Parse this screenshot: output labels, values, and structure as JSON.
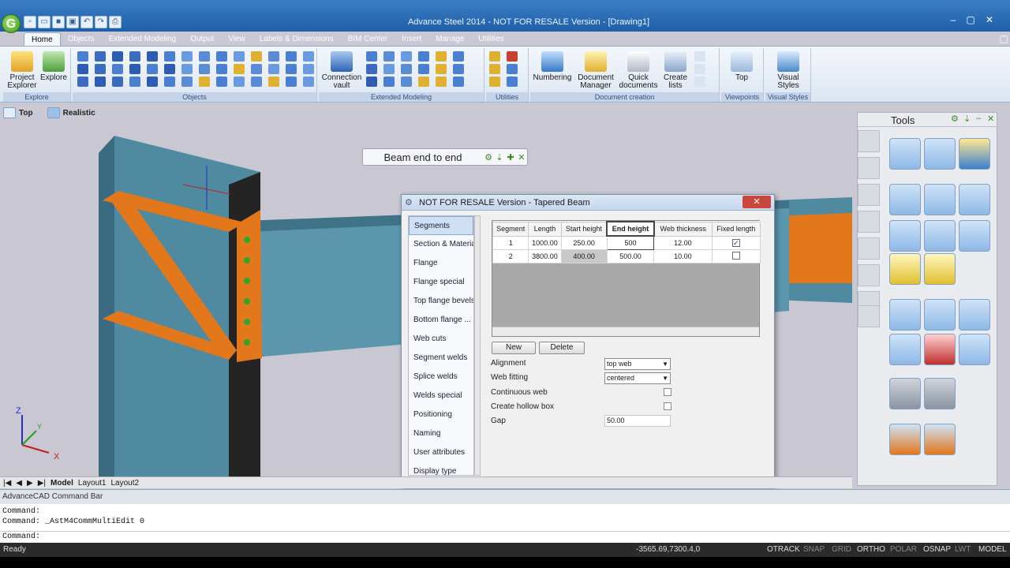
{
  "window": {
    "title": "Advance Steel 2014 - NOT FOR RESALE Version - [Drawing1]",
    "logo": "G"
  },
  "tabs": [
    "Home",
    "Objects",
    "Extended Modeling",
    "Output",
    "View",
    "Labels & Dimensions",
    "BIM Center",
    "Insert",
    "Manage",
    "Utilities"
  ],
  "ribbon": {
    "explore": {
      "label": "Explore",
      "project_explorer": "Project Explorer",
      "explore": "Explore"
    },
    "objects": {
      "label": "Objects"
    },
    "extended_modeling": {
      "label": "Extended Modeling",
      "connection_vault": "Connection vault"
    },
    "utilities": {
      "label": "Utilities"
    },
    "document_creation": {
      "label": "Document creation",
      "numbering": "Numbering",
      "document_manager": "Document Manager",
      "quick_documents": "Quick documents",
      "create_lists": "Create lists"
    },
    "viewpoints": {
      "label": "Viewpoints",
      "top": "Top"
    },
    "visual_styles": {
      "label": "Visual Styles",
      "visual_styles": "Visual Styles"
    }
  },
  "viewbar": {
    "view": "Top",
    "style": "Realistic"
  },
  "floating_toolbar": {
    "label": "Beam end to end"
  },
  "tools_palette": {
    "title": "Tools"
  },
  "dialog": {
    "title": "NOT FOR RESALE Version - Tapered Beam",
    "nav": [
      "Segments",
      "Section & Material",
      "Flange",
      "Flange special",
      "Top flange bevels",
      "Bottom flange ...",
      "Web cuts",
      "Segment welds",
      "Splice welds",
      "Welds special",
      "Positioning",
      "Naming",
      "User attributes",
      "Display type"
    ],
    "grid_headers": [
      "Segment",
      "Length",
      "Start height",
      "End height",
      "Web thickness",
      "Fixed length"
    ],
    "rows": [
      {
        "segment": "1",
        "length": "1000.00",
        "start_height": "250.00",
        "end_height": "500",
        "web_thickness": "12.00",
        "fixed": "✓"
      },
      {
        "segment": "2",
        "length": "3800.00",
        "start_height": "400.00",
        "end_height": "500.00",
        "web_thickness": "10.00",
        "fixed": ""
      }
    ],
    "new_btn": "New",
    "delete_btn": "Delete",
    "fields": {
      "alignment_label": "Alignment",
      "alignment_value": "top web",
      "web_fitting_label": "Web fitting",
      "web_fitting_value": "centered",
      "continuous_web_label": "Continuous web",
      "hollow_box_label": "Create hollow box",
      "gap_label": "Gap",
      "gap_value": "50.00"
    }
  },
  "layouts": [
    "Model",
    "Layout1",
    "Layout2"
  ],
  "command_bar": {
    "title": "AdvanceCAD Command Bar",
    "lines": [
      "Command:",
      "Command: _AstM4CommMultiEdit 0",
      "Command:"
    ]
  },
  "status": {
    "ready": "Ready",
    "coords": "-3565.69,7300.4,0",
    "toggles": [
      "OTRACK",
      "SNAP",
      "GRID",
      "ORTHO",
      "POLAR",
      "OSNAP",
      "LWT",
      "MODEL"
    ]
  },
  "axes": {
    "z": "Z",
    "y": "Y",
    "x": "X"
  },
  "colors": {
    "accent": "#1f5fa8",
    "steel": "#4f8aa0",
    "brace": "#e2771c",
    "bolt": "#2ea82a"
  }
}
